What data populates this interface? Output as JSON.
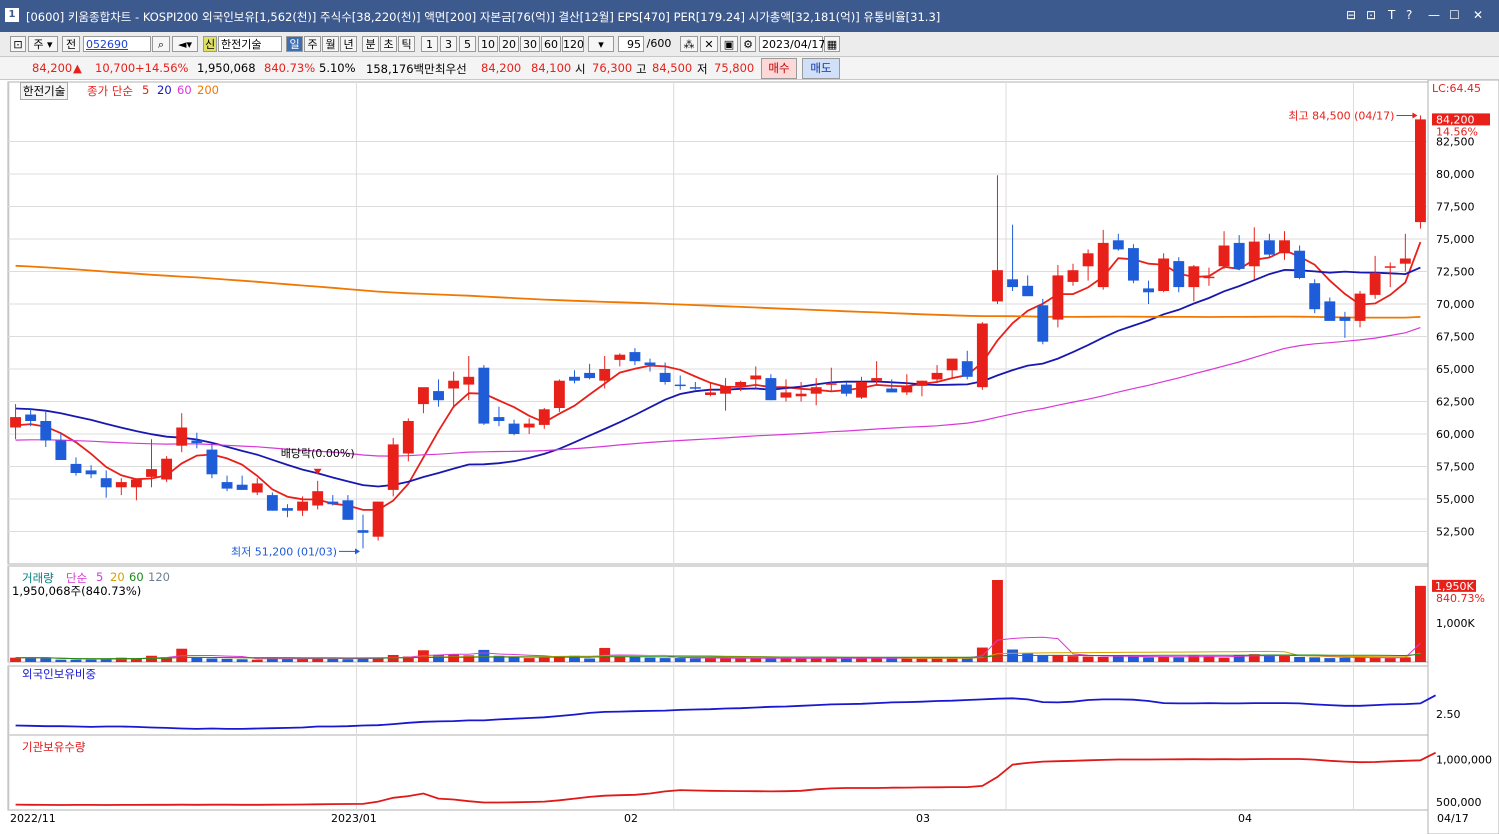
{
  "window": {
    "title": "[0600] 키움종합차트 - KOSPI200 외국인보유[1,562(천)] 주식수[38,220(천)] 액면[200] 자본금[76(억)] 결산[12월] EPS[470] PER[179.24] 시가총액[32,181(억)] 유통비율[31.3]",
    "icon": "1",
    "controls": [
      "⊟",
      "⊡",
      "T",
      "?",
      "—",
      "☐",
      "✕"
    ]
  },
  "toolbar": {
    "period": "주",
    "all": "전",
    "code": "052690",
    "stock_name": "한전기술",
    "badge": "신",
    "intervals": [
      "일",
      "주",
      "월",
      "년",
      "분",
      "초",
      "틱"
    ],
    "minutes": [
      "1",
      "3",
      "5",
      "10",
      "20",
      "30",
      "60",
      "120"
    ],
    "count": "95",
    "total": "/600",
    "date": "2023/04/17"
  },
  "quote": {
    "price": "84,200",
    "arrow": "▲",
    "change": "10,700",
    "change_pct": "+14.56%",
    "volume": "1,950,068",
    "vol_ratio": "840.73%",
    "turnover": "5.10%",
    "amount": "158,176백만",
    "best_label": "최우선",
    "best_ask": "84,200",
    "best_bid": "84,100",
    "open_label": "시",
    "open": "76,300",
    "high_label": "고",
    "high": "84,500",
    "low_label": "저",
    "low": "75,800",
    "buy": "매수",
    "sell": "매도"
  },
  "colors": {
    "up": "#e8201a",
    "down": "#1e5cd8",
    "ma5": "#e8201a",
    "ma20": "#1818b0",
    "ma60": "#d838d8",
    "ma200": "#f07800",
    "foreign": "#1818d0",
    "inst": "#e01818",
    "titlebar": "#3d5a8e"
  },
  "chart_data": {
    "type": "candlestick",
    "legend": {
      "name": "한전기술",
      "ma_title": "종가 단순",
      "ma_periods": [
        "5",
        "20",
        "60",
        "200"
      ]
    },
    "x_labels": [
      "2022/11",
      "2023/01",
      "02",
      "03",
      "04",
      "04/17"
    ],
    "ylim": [
      50000,
      86000
    ],
    "y_ticks": [
      52500,
      55000,
      57500,
      60000,
      62500,
      65000,
      67500,
      70000,
      72500,
      75000,
      77500,
      80000,
      82500
    ],
    "y_tick_labels": [
      "52,500",
      "55,000",
      "57,500",
      "60,000",
      "62,500",
      "65,000",
      "67,500",
      "70,000",
      "72,500",
      "75,000",
      "77,500",
      "80,000",
      "82,500"
    ],
    "right_labels": {
      "lc": "LC:64.45",
      "price": "84,200",
      "pct": "14.56%"
    },
    "annotations": {
      "high": "최고 84,500 (04/17)",
      "low": "최저 51,200 (01/03)",
      "dividend": "배당락(0.00%)"
    },
    "candles": [
      {
        "o": 60500,
        "h": 62300,
        "l": 59600,
        "c": 61300
      },
      {
        "o": 61500,
        "h": 62000,
        "l": 60600,
        "c": 61000
      },
      {
        "o": 61000,
        "h": 61800,
        "l": 59000,
        "c": 59500
      },
      {
        "o": 59500,
        "h": 60100,
        "l": 58200,
        "c": 58000
      },
      {
        "o": 57700,
        "h": 58200,
        "l": 56800,
        "c": 57000
      },
      {
        "o": 57200,
        "h": 57600,
        "l": 56600,
        "c": 56900
      },
      {
        "o": 56600,
        "h": 57200,
        "l": 55100,
        "c": 55900
      },
      {
        "o": 55900,
        "h": 56600,
        "l": 55300,
        "c": 56300
      },
      {
        "o": 55900,
        "h": 56400,
        "l": 54900,
        "c": 56500
      },
      {
        "o": 56700,
        "h": 59600,
        "l": 55900,
        "c": 57300
      },
      {
        "o": 56500,
        "h": 58300,
        "l": 56300,
        "c": 58100
      },
      {
        "o": 59100,
        "h": 61600,
        "l": 58600,
        "c": 60500
      },
      {
        "o": 59500,
        "h": 60100,
        "l": 58900,
        "c": 59300
      },
      {
        "o": 58800,
        "h": 59300,
        "l": 56600,
        "c": 56900
      },
      {
        "o": 56300,
        "h": 56800,
        "l": 55600,
        "c": 55800
      },
      {
        "o": 56100,
        "h": 56800,
        "l": 55700,
        "c": 55700
      },
      {
        "o": 55500,
        "h": 56600,
        "l": 55300,
        "c": 56200
      },
      {
        "o": 55300,
        "h": 55500,
        "l": 54100,
        "c": 54100
      },
      {
        "o": 54300,
        "h": 54600,
        "l": 53600,
        "c": 54100
      },
      {
        "o": 54100,
        "h": 55200,
        "l": 53700,
        "c": 54800
      },
      {
        "o": 54500,
        "h": 56400,
        "l": 54200,
        "c": 55600
      },
      {
        "o": 54800,
        "h": 55300,
        "l": 54500,
        "c": 54600
      },
      {
        "o": 54900,
        "h": 55300,
        "l": 53400,
        "c": 53400
      },
      {
        "o": 52600,
        "h": 53800,
        "l": 51200,
        "c": 52400
      },
      {
        "o": 52100,
        "h": 54700,
        "l": 51800,
        "c": 54800
      },
      {
        "o": 55700,
        "h": 59700,
        "l": 55200,
        "c": 59200
      },
      {
        "o": 58500,
        "h": 61200,
        "l": 57900,
        "c": 61000
      },
      {
        "o": 62300,
        "h": 63500,
        "l": 61600,
        "c": 63600
      },
      {
        "o": 63300,
        "h": 64200,
        "l": 62100,
        "c": 62600
      },
      {
        "o": 63500,
        "h": 64800,
        "l": 62000,
        "c": 64100
      },
      {
        "o": 63800,
        "h": 66000,
        "l": 62600,
        "c": 64400
      },
      {
        "o": 65100,
        "h": 65300,
        "l": 60700,
        "c": 60800
      },
      {
        "o": 61300,
        "h": 62100,
        "l": 60600,
        "c": 61000
      },
      {
        "o": 60800,
        "h": 61100,
        "l": 59900,
        "c": 60000
      },
      {
        "o": 60500,
        "h": 61200,
        "l": 60000,
        "c": 60800
      },
      {
        "o": 60700,
        "h": 62000,
        "l": 60400,
        "c": 61900
      },
      {
        "o": 62000,
        "h": 64200,
        "l": 61700,
        "c": 64100
      },
      {
        "o": 64400,
        "h": 64900,
        "l": 63900,
        "c": 64100
      },
      {
        "o": 64700,
        "h": 65400,
        "l": 64200,
        "c": 64300
      },
      {
        "o": 64100,
        "h": 66000,
        "l": 63500,
        "c": 65000
      },
      {
        "o": 65700,
        "h": 66200,
        "l": 65200,
        "c": 66100
      },
      {
        "o": 66300,
        "h": 66600,
        "l": 65300,
        "c": 65600
      },
      {
        "o": 65500,
        "h": 65800,
        "l": 64800,
        "c": 65300
      },
      {
        "o": 64700,
        "h": 65500,
        "l": 63800,
        "c": 64000
      },
      {
        "o": 63800,
        "h": 64500,
        "l": 63400,
        "c": 63700
      },
      {
        "o": 63600,
        "h": 64000,
        "l": 63400,
        "c": 63500
      },
      {
        "o": 63000,
        "h": 64000,
        "l": 62900,
        "c": 63200
      },
      {
        "o": 63100,
        "h": 64300,
        "l": 61800,
        "c": 63700
      },
      {
        "o": 63700,
        "h": 64100,
        "l": 63300,
        "c": 64000
      },
      {
        "o": 64200,
        "h": 65200,
        "l": 63500,
        "c": 64500
      },
      {
        "o": 64300,
        "h": 64600,
        "l": 62600,
        "c": 62600
      },
      {
        "o": 62800,
        "h": 64200,
        "l": 62500,
        "c": 63200
      },
      {
        "o": 62900,
        "h": 64000,
        "l": 62500,
        "c": 63100
      },
      {
        "o": 63100,
        "h": 64300,
        "l": 62200,
        "c": 63600
      },
      {
        "o": 63800,
        "h": 65100,
        "l": 63300,
        "c": 63900
      },
      {
        "o": 63800,
        "h": 64000,
        "l": 62900,
        "c": 63100
      },
      {
        "o": 62800,
        "h": 64400,
        "l": 62700,
        "c": 64000
      },
      {
        "o": 64100,
        "h": 65600,
        "l": 63700,
        "c": 64300
      },
      {
        "o": 63500,
        "h": 64200,
        "l": 63300,
        "c": 63200
      },
      {
        "o": 63200,
        "h": 64600,
        "l": 63000,
        "c": 63700
      },
      {
        "o": 63700,
        "h": 64100,
        "l": 62900,
        "c": 64100
      },
      {
        "o": 64200,
        "h": 65300,
        "l": 64000,
        "c": 64700
      },
      {
        "o": 64900,
        "h": 65700,
        "l": 64300,
        "c": 65800
      },
      {
        "o": 65600,
        "h": 66400,
        "l": 64200,
        "c": 64400
      },
      {
        "o": 63600,
        "h": 68600,
        "l": 63400,
        "c": 68500
      },
      {
        "o": 70200,
        "h": 79900,
        "l": 70000,
        "c": 72600
      },
      {
        "o": 71900,
        "h": 76100,
        "l": 71000,
        "c": 71300
      },
      {
        "o": 71400,
        "h": 72200,
        "l": 70700,
        "c": 70600
      },
      {
        "o": 69900,
        "h": 70400,
        "l": 66900,
        "c": 67100
      },
      {
        "o": 68800,
        "h": 73000,
        "l": 68200,
        "c": 72200
      },
      {
        "o": 71700,
        "h": 73100,
        "l": 71400,
        "c": 72600
      },
      {
        "o": 72900,
        "h": 74200,
        "l": 71800,
        "c": 73900
      },
      {
        "o": 71300,
        "h": 75700,
        "l": 71100,
        "c": 74700
      },
      {
        "o": 74900,
        "h": 75400,
        "l": 74100,
        "c": 74200
      },
      {
        "o": 74300,
        "h": 74600,
        "l": 71600,
        "c": 71800
      },
      {
        "o": 71200,
        "h": 71800,
        "l": 70000,
        "c": 70900
      },
      {
        "o": 71000,
        "h": 73900,
        "l": 70900,
        "c": 73500
      },
      {
        "o": 73300,
        "h": 73600,
        "l": 70900,
        "c": 71300
      },
      {
        "o": 71300,
        "h": 73000,
        "l": 70200,
        "c": 72900
      },
      {
        "o": 72000,
        "h": 72800,
        "l": 71400,
        "c": 72100
      },
      {
        "o": 72900,
        "h": 75600,
        "l": 72700,
        "c": 74500
      },
      {
        "o": 74700,
        "h": 75300,
        "l": 72600,
        "c": 72700
      },
      {
        "o": 72900,
        "h": 75900,
        "l": 71900,
        "c": 74800
      },
      {
        "o": 74900,
        "h": 75400,
        "l": 73600,
        "c": 73800
      },
      {
        "o": 73900,
        "h": 75600,
        "l": 73400,
        "c": 74900
      },
      {
        "o": 74100,
        "h": 74500,
        "l": 71900,
        "c": 72000
      },
      {
        "o": 71600,
        "h": 71900,
        "l": 69300,
        "c": 69600
      },
      {
        "o": 70200,
        "h": 70500,
        "l": 68900,
        "c": 68700
      },
      {
        "o": 69000,
        "h": 69400,
        "l": 67400,
        "c": 68700
      },
      {
        "o": 68700,
        "h": 71000,
        "l": 68200,
        "c": 70800
      },
      {
        "o": 70700,
        "h": 73700,
        "l": 70400,
        "c": 72400
      },
      {
        "o": 72800,
        "h": 73200,
        "l": 71300,
        "c": 72900
      },
      {
        "o": 73100,
        "h": 75400,
        "l": 72500,
        "c": 73500
      },
      {
        "o": 76300,
        "h": 84500,
        "l": 75800,
        "c": 84200
      }
    ],
    "volume": {
      "legend_title": "거래량",
      "legend_ma_title": "단순",
      "legend_ma": [
        "5",
        "20",
        "60",
        "120"
      ],
      "info": "1,950,068주(840.73%)",
      "ylim": [
        0,
        2100
      ],
      "y_tick_labels": [
        "1,000K"
      ],
      "y_ticks": [
        1000
      ],
      "right_labels": {
        "value": "1,950K",
        "pct": "840.73%"
      },
      "unit": "K",
      "values": [
        110,
        110,
        100,
        60,
        60,
        60,
        90,
        110,
        90,
        160,
        120,
        340,
        120,
        90,
        80,
        70,
        60,
        120,
        80,
        90,
        100,
        80,
        70,
        110,
        100,
        180,
        140,
        300,
        180,
        200,
        170,
        310,
        160,
        120,
        100,
        110,
        140,
        160,
        90,
        360,
        140,
        130,
        110,
        100,
        100,
        90,
        110,
        100,
        90,
        90,
        90,
        100,
        90,
        100,
        100,
        90,
        100,
        110,
        90,
        90,
        90,
        110,
        110,
        110,
        370,
        2100,
        320,
        220,
        170,
        180,
        150,
        140,
        130,
        160,
        140,
        120,
        140,
        120,
        160,
        150,
        110,
        180,
        200,
        160,
        180,
        130,
        120,
        100,
        110,
        120,
        110,
        100,
        120,
        1950
      ]
    },
    "foreign": {
      "legend": "외국인보유비중",
      "y_ticks": [
        2.5
      ],
      "y_tick_labels": [
        "2.50"
      ],
      "ylim": [
        1.88,
        3.5
      ],
      "values": [
        2.16,
        2.15,
        2.14,
        2.14,
        2.13,
        2.12,
        2.13,
        2.13,
        2.12,
        2.1,
        2.09,
        2.07,
        2.06,
        2.07,
        2.06,
        2.06,
        2.07,
        2.08,
        2.09,
        2.1,
        2.13,
        2.13,
        2.14,
        2.16,
        2.17,
        2.2,
        2.24,
        2.27,
        2.28,
        2.29,
        2.31,
        2.31,
        2.34,
        2.36,
        2.38,
        2.4,
        2.44,
        2.48,
        2.53,
        2.56,
        2.57,
        2.58,
        2.59,
        2.6,
        2.62,
        2.63,
        2.64,
        2.66,
        2.67,
        2.69,
        2.71,
        2.72,
        2.74,
        2.76,
        2.78,
        2.79,
        2.8,
        2.82,
        2.84,
        2.85,
        2.86,
        2.88,
        2.89,
        2.91,
        2.93,
        2.95,
        2.96,
        2.93,
        2.85,
        2.84,
        2.86,
        2.91,
        2.93,
        2.93,
        2.92,
        2.88,
        2.82,
        2.81,
        2.81,
        2.82,
        2.81,
        2.81,
        2.82,
        2.82,
        2.82,
        2.81,
        2.78,
        2.76,
        2.74,
        2.74,
        2.76,
        2.78,
        2.79,
        2.81,
        3.05
      ]
    },
    "inst": {
      "legend": "기관보유수량",
      "y_ticks": [
        500000,
        1000000
      ],
      "y_tick_labels": [
        "500,000",
        "1,000,000"
      ],
      "ylim": [
        430000,
        1170000
      ],
      "values": [
        470000,
        468000,
        466000,
        465000,
        466000,
        466000,
        465000,
        466000,
        467000,
        468000,
        468000,
        469000,
        468000,
        469000,
        469000,
        468000,
        468000,
        469000,
        470000,
        471000,
        474000,
        476000,
        477000,
        478000,
        505000,
        550000,
        570000,
        600000,
        540000,
        530000,
        510000,
        495000,
        495000,
        497000,
        500000,
        505000,
        520000,
        540000,
        560000,
        575000,
        580000,
        585000,
        600000,
        625000,
        640000,
        635000,
        632000,
        630000,
        628000,
        627000,
        625000,
        627000,
        632000,
        650000,
        660000,
        665000,
        665000,
        665000,
        668000,
        670000,
        672000,
        673000,
        675000,
        676000,
        690000,
        795000,
        940000,
        960000,
        975000,
        980000,
        985000,
        990000,
        995000,
        1000000,
        1000000,
        1000000,
        1001000,
        1002000,
        1003000,
        1002000,
        1003000,
        1002000,
        1004000,
        1005000,
        1006000,
        1005000,
        998000,
        985000,
        975000,
        968000,
        970000,
        978000,
        985000,
        990000,
        1080000
      ]
    }
  }
}
